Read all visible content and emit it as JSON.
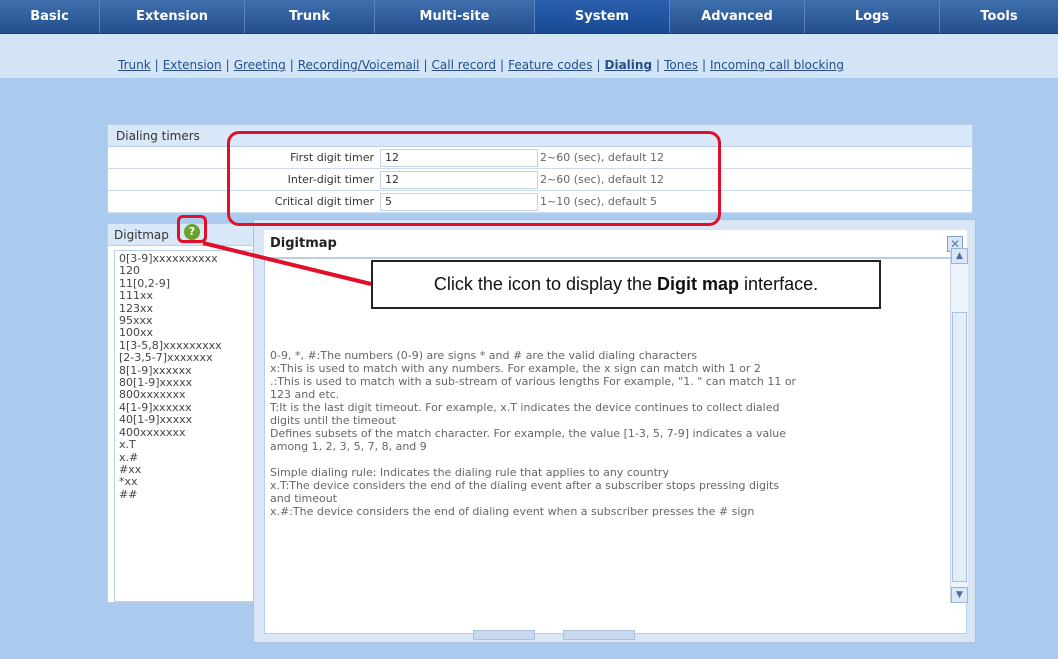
{
  "topnav": {
    "tabs": [
      {
        "label": "Basic"
      },
      {
        "label": "Extension"
      },
      {
        "label": "Trunk"
      },
      {
        "label": "Multi-site"
      },
      {
        "label": "System",
        "active": true
      },
      {
        "label": "Advanced"
      },
      {
        "label": "Logs"
      },
      {
        "label": "Tools"
      }
    ]
  },
  "subnav": {
    "links": [
      {
        "label": "Trunk"
      },
      {
        "label": "Extension"
      },
      {
        "label": "Greeting"
      },
      {
        "label": "Recording/Voicemail"
      },
      {
        "label": "Call record"
      },
      {
        "label": "Feature codes"
      },
      {
        "label": "Dialing",
        "active": true
      },
      {
        "label": "Tones"
      },
      {
        "label": "Incoming call blocking"
      }
    ]
  },
  "dialing_timers": {
    "title": "Dialing timers",
    "rows": [
      {
        "label": "First digit timer",
        "value": "12",
        "hint": "2~60 (sec), default 12"
      },
      {
        "label": "Inter-digit timer",
        "value": "12",
        "hint": "2~60 (sec), default 12"
      },
      {
        "label": "Critical digit timer",
        "value": "5",
        "hint": "1~10 (sec), default 5"
      }
    ]
  },
  "digitmap": {
    "title": "Digitmap",
    "help_icon": "question-icon",
    "entries": [
      "0[3-9]xxxxxxxxxx",
      "120",
      "11[0,2-9]",
      "111xx",
      "123xx",
      "95xxx",
      "100xx",
      "1[3-5,8]xxxxxxxxx",
      "[2-3,5-7]xxxxxxx",
      "8[1-9]xxxxxx",
      "80[1-9]xxxxx",
      "800xxxxxxx",
      "4[1-9]xxxxxx",
      "40[1-9]xxxxx",
      "400xxxxxxx",
      "x.T",
      "x.#",
      "#xx",
      "*xx",
      "##"
    ]
  },
  "modal": {
    "title": "Digitmap",
    "close_icon": "close-icon",
    "lines": [
      "0-9, *, #:The numbers (0-9) are signs * and # are the valid dialing characters",
      "x:This is used to match with any numbers. For example, the x sign can match with 1 or 2",
      ".:This is used to match with a sub-stream of various lengths For example, \"1. \" can match 11 or",
      "123 and etc.",
      "T:It is the last digit timeout. For example, x.T indicates the device continues to collect dialed",
      "digits until the timeout",
      "Defines subsets of the match character. For example, the value [1-3, 5, 7-9] indicates a value",
      "among 1, 2, 3, 5, 7, 8, and 9",
      "",
      "Simple dialing rule: Indicates the dialing rule that applies to any country",
      "x.T:The device considers the end of the dialing event after a subscriber stops pressing digits",
      "and timeout",
      "x.#:The device considers the end of dialing event when a subscriber presses the # sign"
    ]
  },
  "callout": {
    "prefix": "Click the icon to display the ",
    "bold": "Digit map",
    "suffix": " interface."
  },
  "colors": {
    "nav": "#244f8e",
    "background": "#aacbee",
    "highlight": "#e0102a"
  }
}
